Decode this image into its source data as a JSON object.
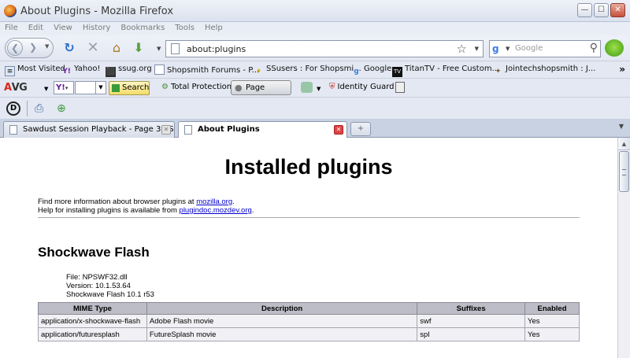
{
  "window": {
    "title": "About Plugins - Mozilla Firefox"
  },
  "menu": [
    "File",
    "Edit",
    "View",
    "History",
    "Bookmarks",
    "Tools",
    "Help"
  ],
  "nav": {
    "url": "about:plugins",
    "search_placeholder": "Google"
  },
  "bookmarks": [
    "Most Visited",
    "Yahoo!",
    "ssug.org",
    "Shopsmith Forums - P...",
    "SSusers : For Shopsmi...",
    "Google",
    "TitanTV - Free Custom...",
    "Jointechshopsmith : J..."
  ],
  "avg": {
    "logo_a": "A",
    "logo_rest": "VG",
    "search": "Search",
    "protection": "Total Protection",
    "page_status": "Page Status",
    "identity": "Identity Guard"
  },
  "tabs": [
    {
      "label": "Sawdust Session Playback - Page 3 - S...",
      "active": false
    },
    {
      "label": "About Plugins",
      "active": true
    }
  ],
  "page": {
    "heading": "Installed plugins",
    "info_line1_pre": "Find more information about browser plugins at ",
    "info_line1_link": "mozilla.org",
    "info_line1_post": ".",
    "info_line2_pre": "Help for installing plugins is available from ",
    "info_line2_link": "plugindoc.mozdev.org",
    "info_line2_post": ".",
    "plugin": {
      "name": "Shockwave Flash",
      "file": "File: NPSWF32.dll",
      "version": "Version: 10.1.53.64",
      "description": "Shockwave Flash 10.1 r53"
    },
    "table": {
      "headers": [
        "MIME Type",
        "Description",
        "Suffixes",
        "Enabled"
      ],
      "rows": [
        [
          "application/x-shockwave-flash",
          "Adobe Flash movie",
          "swf",
          "Yes"
        ],
        [
          "application/futuresplash",
          "FutureSplash movie",
          "spl",
          "Yes"
        ]
      ]
    }
  }
}
